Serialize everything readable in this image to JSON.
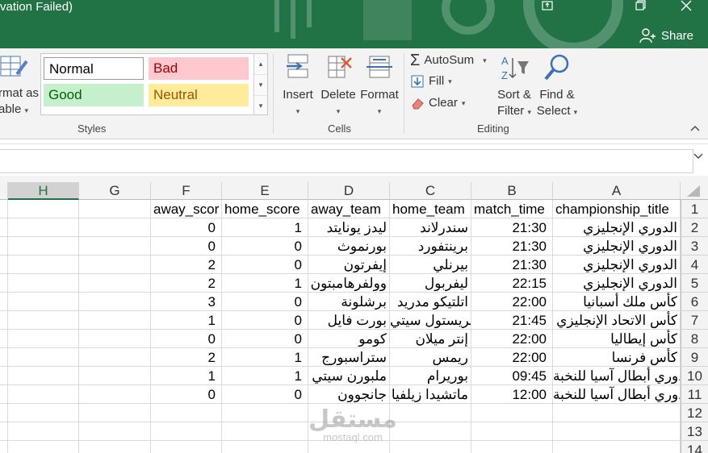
{
  "window": {
    "title": "vation Failed)",
    "share_label": "Share"
  },
  "ribbon": {
    "styles": {
      "group_label": "Styles",
      "format_as_table_line1": "rmat as",
      "format_as_table_line2": "able",
      "normal": "Normal",
      "bad": "Bad",
      "good": "Good",
      "neutral": "Neutral"
    },
    "cells": {
      "group_label": "Cells",
      "insert": "Insert",
      "delete": "Delete",
      "format": "Format"
    },
    "editing": {
      "group_label": "Editing",
      "autosum": "AutoSum",
      "fill": "Fill",
      "clear": "Clear",
      "sort_line1": "Sort &",
      "sort_line2": "Filter",
      "find_line1": "Find &",
      "find_line2": "Select"
    }
  },
  "colors": {
    "accent": "#217346",
    "bad_bg": "#ffc7ce",
    "bad_fg": "#9c0006",
    "good_bg": "#c6efce",
    "good_fg": "#006100",
    "neutral_bg": "#ffeb9c",
    "neutral_fg": "#9c5700"
  },
  "sheet": {
    "columns": [
      "H",
      "G",
      "F",
      "E",
      "D",
      "C",
      "B",
      "A"
    ],
    "selected_column": "H",
    "row_numbers": [
      "1",
      "2",
      "3",
      "4",
      "5",
      "6",
      "7",
      "8",
      "9",
      "10",
      "11",
      "12",
      "13",
      "14"
    ],
    "headers": {
      "A": "championship_title",
      "B": "match_time",
      "C": "home_team",
      "D": "away_team",
      "E": "home_score",
      "F": "away_scor"
    },
    "rows": [
      {
        "A": "الدوري الإنجليزي",
        "B": "21:30",
        "C": "سندرلاند",
        "D": "ليدز يونايتد",
        "E": "1",
        "F": "0"
      },
      {
        "A": "الدوري الإنجليزي",
        "B": "21:30",
        "C": "برينتفورد",
        "D": "بورنموث",
        "E": "0",
        "F": "0"
      },
      {
        "A": "الدوري الإنجليزي",
        "B": "21:30",
        "C": "بيرنلي",
        "D": "إيفرتون",
        "E": "0",
        "F": "2"
      },
      {
        "A": "الدوري الإنجليزي",
        "B": "22:15",
        "C": "ليفربول",
        "D": "وولفرهامبتون",
        "E": "1",
        "F": "2"
      },
      {
        "A": "كأس ملك أسبانيا",
        "B": "22:00",
        "C": "اتلتيكو مدريد",
        "D": "برشلونة",
        "E": "0",
        "F": "3"
      },
      {
        "A": "كأس الاتحاد الإنجليزي",
        "B": "21:45",
        "C": "بريستول سيتي",
        "D": "بورت فايل",
        "E": "0",
        "F": "1"
      },
      {
        "A": "كأس إيطاليا",
        "B": "22:00",
        "C": "إنتر ميلان",
        "D": "كومو",
        "E": "0",
        "F": "0"
      },
      {
        "A": "كأس فرنسا",
        "B": "22:00",
        "C": "ريمس",
        "D": "ستراسبورج",
        "E": "1",
        "F": "2"
      },
      {
        "A": "دوري أبطال آسيا للنخبة",
        "B": "09:45",
        "C": "بوريرام",
        "D": "ملبورن سيتي",
        "E": "1",
        "F": "1"
      },
      {
        "A": "دوري أبطال آسيا للنخبة",
        "B": "12:00",
        "C": "ماتشيدا زيلفيا",
        "D": "جانجوون",
        "E": "0",
        "F": "0"
      }
    ]
  },
  "watermark": {
    "arabic": "مستقل",
    "latin": "mostaql.com"
  }
}
